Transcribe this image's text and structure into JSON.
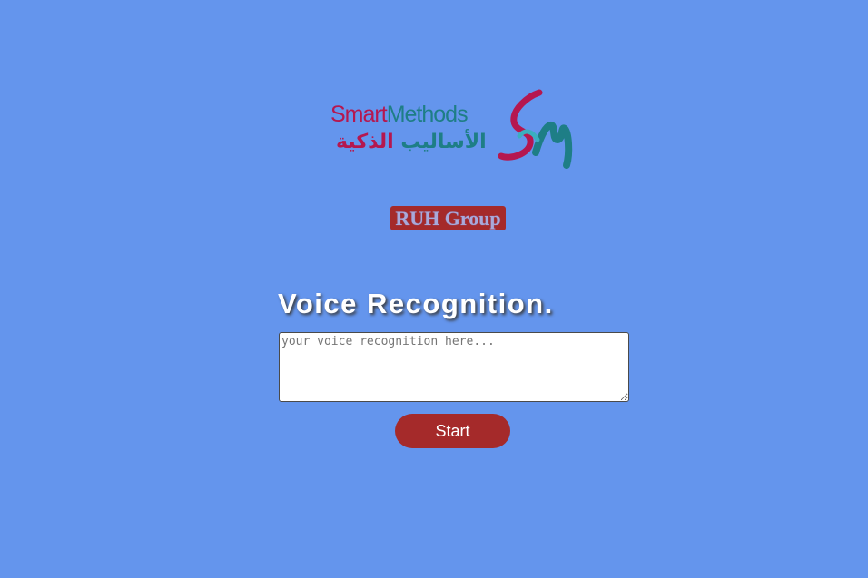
{
  "logo": {
    "latin_part1": "Smart",
    "latin_part2": "Methods",
    "arabic_part1": "الأساليب",
    "arabic_part2": "الذكية",
    "colors": {
      "crimson": "#B5174F",
      "teal": "#1E7E86"
    }
  },
  "group": {
    "label": "RUH Group"
  },
  "main": {
    "title": "Voice Recognition.",
    "textarea_placeholder": "your voice recognition here...",
    "start_label": "Start"
  },
  "colors": {
    "background": "#6495ED",
    "accent": "#A52A2A",
    "white": "#FFFFFF"
  }
}
